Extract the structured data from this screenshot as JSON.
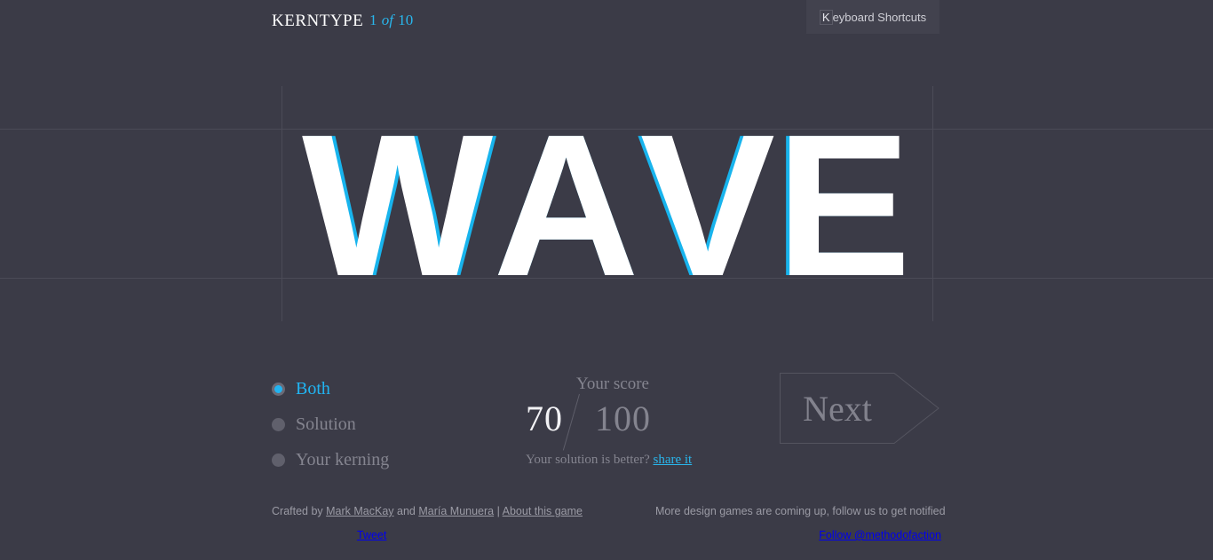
{
  "header": {
    "brand": "KERNTYPE",
    "counter_current": "1",
    "counter_of": "of",
    "counter_total": "10",
    "keyboard_shortcuts_key": "K",
    "keyboard_shortcuts_rest": "eyboard Shortcuts"
  },
  "stage": {
    "word": "WAVE",
    "letters": [
      "W",
      "A",
      "V",
      "E"
    ],
    "kerning_color": "#ffffff",
    "solution_color": "#18b4ed",
    "background": "#3b3b47",
    "guide_color": "#4b4b57"
  },
  "controls": {
    "options": [
      {
        "label": "Both",
        "selected": true
      },
      {
        "label": "Solution",
        "selected": false
      },
      {
        "label": "Your kerning",
        "selected": false
      }
    ]
  },
  "score": {
    "title": "Your score",
    "value": "70",
    "separator": "/",
    "total": "100",
    "share_prompt": "Your solution is better?",
    "share_link": "share it"
  },
  "next": {
    "label": "Next"
  },
  "footer": {
    "crafted_prefix": "Crafted by ",
    "author_one": "Mark MacKay",
    "crafted_and": " and ",
    "author_two": "María Munuera",
    "separator": " | ",
    "about_link": "About this game",
    "tweet": "Tweet",
    "promo": "More design games are coming up, follow us to get notified",
    "follow": "Follow @methodofaction"
  },
  "colors": {
    "accent": "#29b6ec",
    "background": "#3b3b47",
    "muted_text": "#84848f"
  }
}
